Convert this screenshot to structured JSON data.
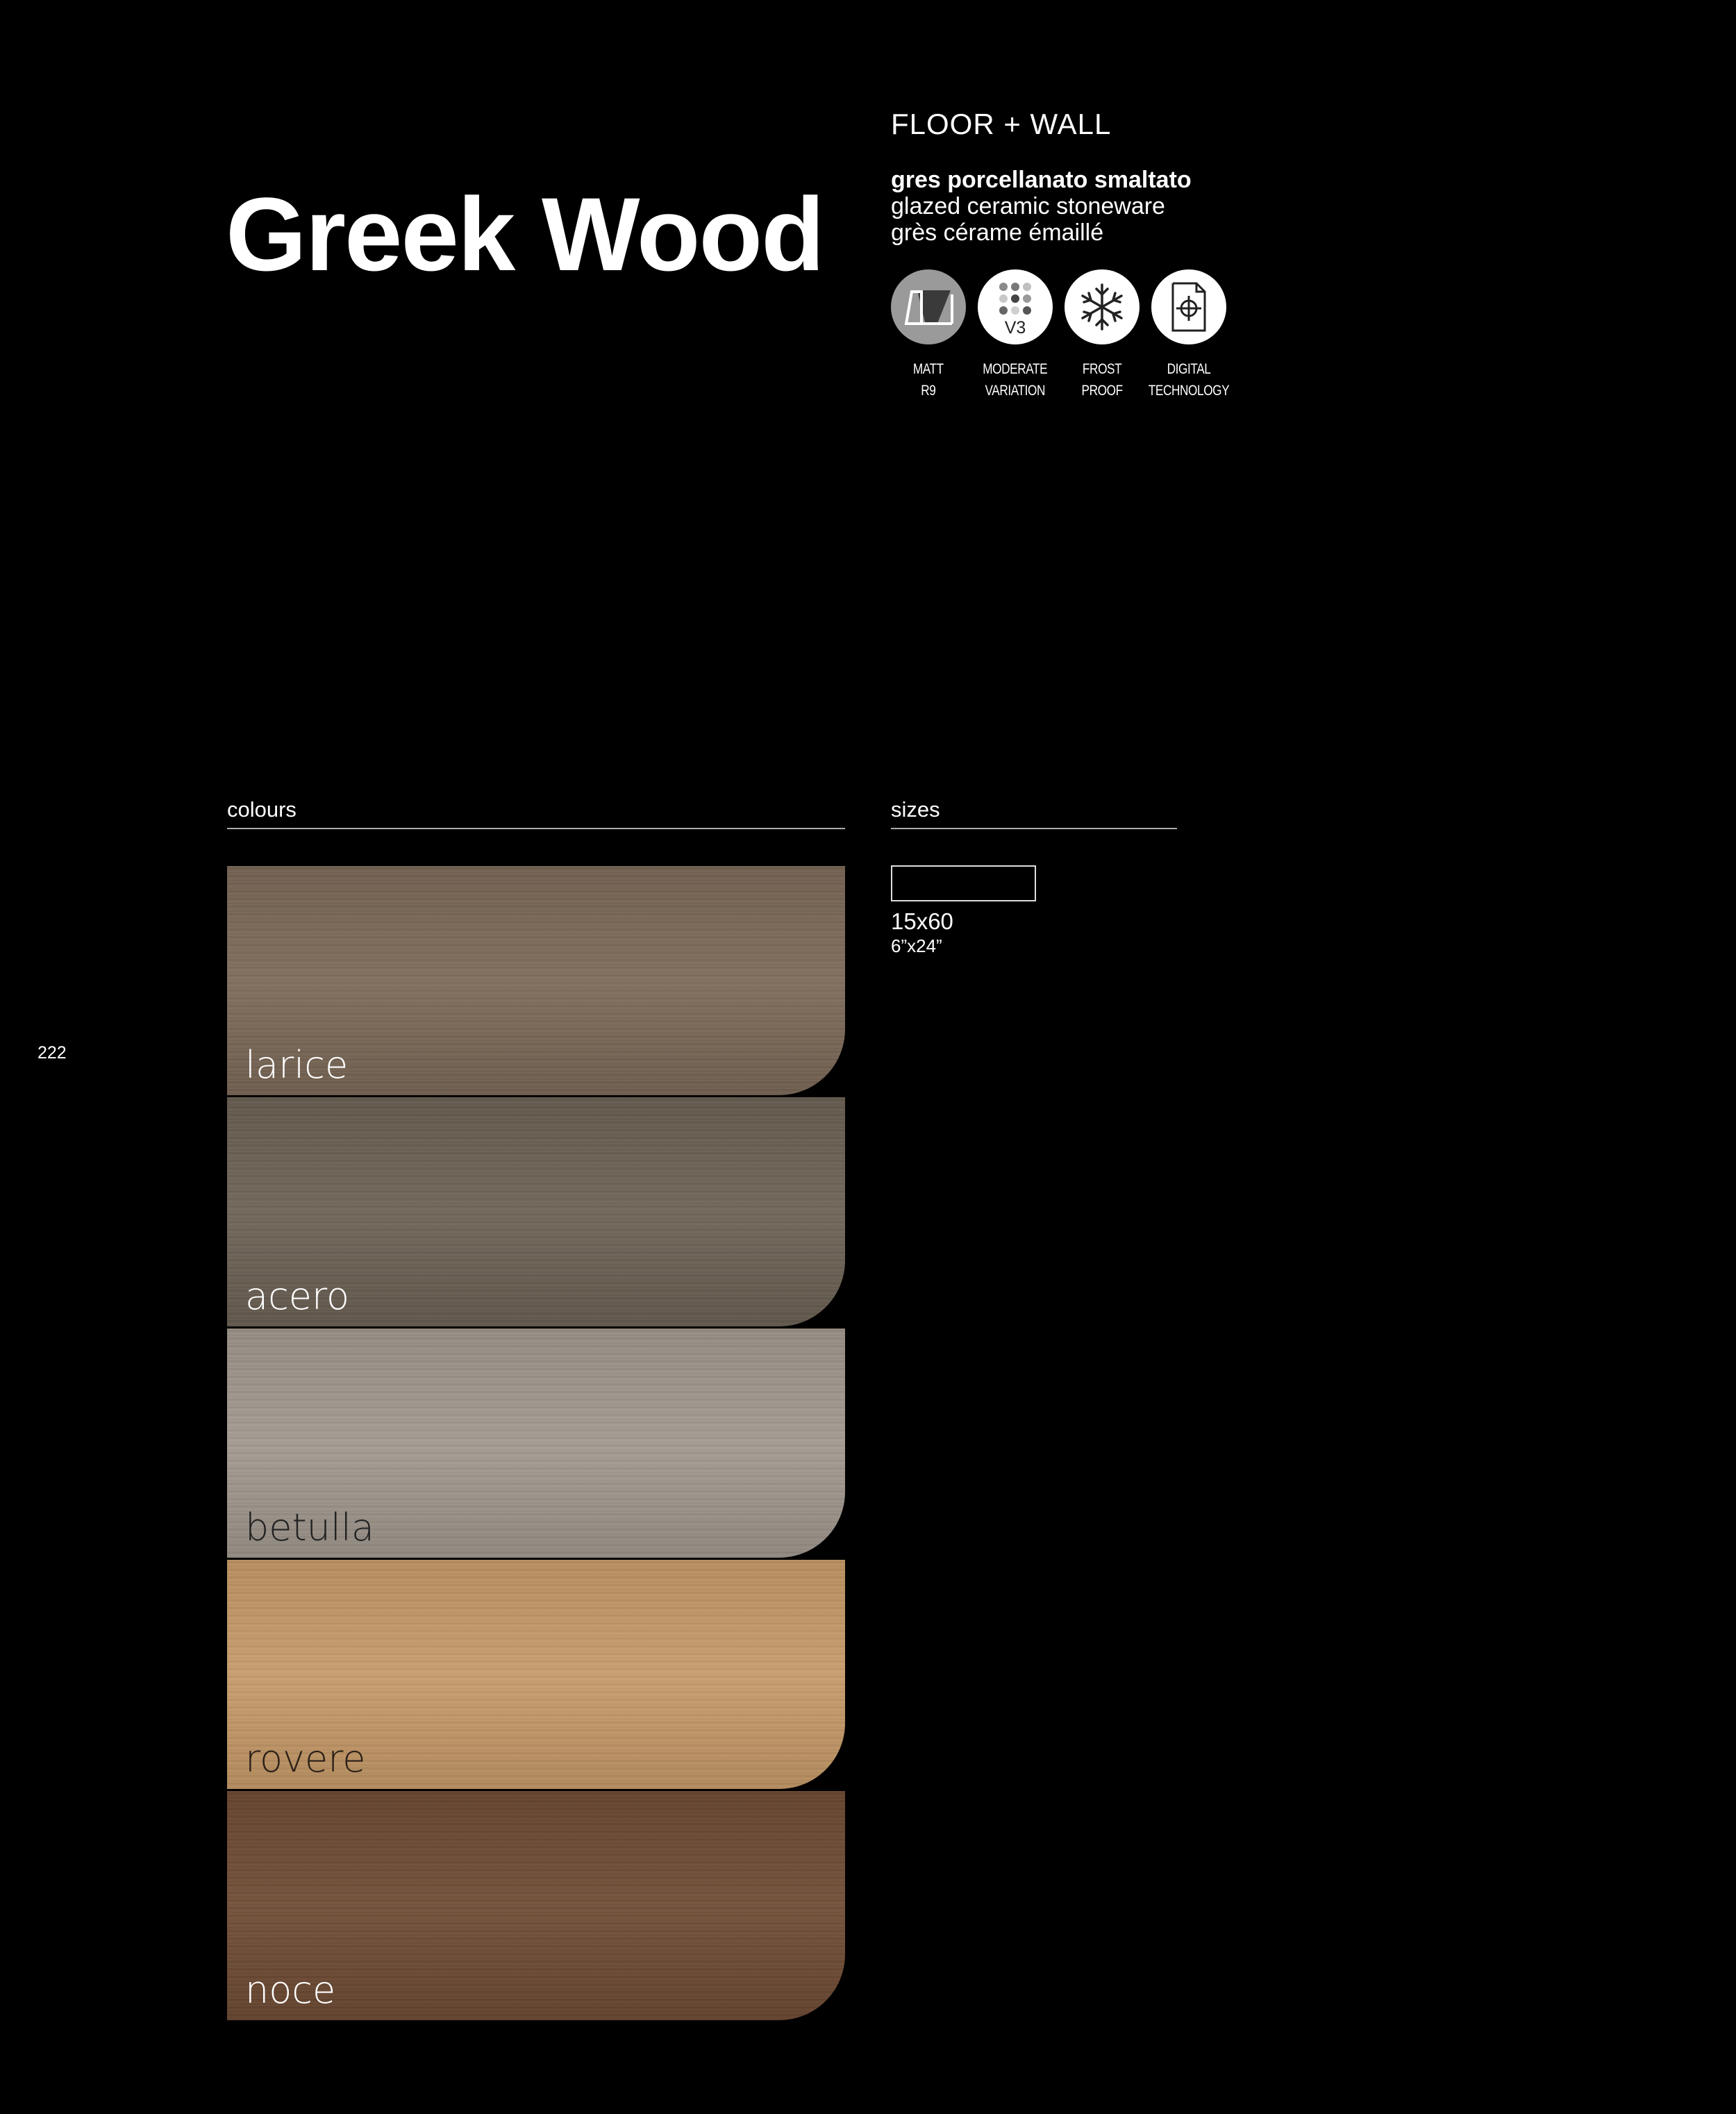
{
  "title": "Greek Wood",
  "category": "FLOOR + WALL",
  "material": {
    "it": "gres porcellanato smaltato",
    "en": "glazed ceramic stoneware",
    "fr": "grès cérame émaillé"
  },
  "features": [
    {
      "icon": "matt-slip-icon",
      "line1": "MATT",
      "line2": "R9"
    },
    {
      "icon": "variation-icon",
      "line1": "MODERATE",
      "line2": "VARIATION",
      "badge": "V3"
    },
    {
      "icon": "snowflake-icon",
      "line1": "FROST",
      "line2": "PROOF"
    },
    {
      "icon": "digital-print-icon",
      "line1": "DIGITAL",
      "line2": "TECHNOLOGY"
    }
  ],
  "page_number": "222",
  "colours": {
    "heading": "colours",
    "items": [
      {
        "name": "larice",
        "color": "#7d6a58",
        "label_color": "#ffffff"
      },
      {
        "name": "acero",
        "color": "#6d6255",
        "label_color": "#ffffff"
      },
      {
        "name": "betulla",
        "color": "#a39a90",
        "label_color": "#222222"
      },
      {
        "name": "rovere",
        "color": "#c99c69",
        "label_color": "#2a2018"
      },
      {
        "name": "noce",
        "color": "#6f4b33",
        "label_color": "#ffffff"
      }
    ]
  },
  "sizes": {
    "heading": "sizes",
    "metric": "15x60",
    "imperial": "6”x24”"
  }
}
